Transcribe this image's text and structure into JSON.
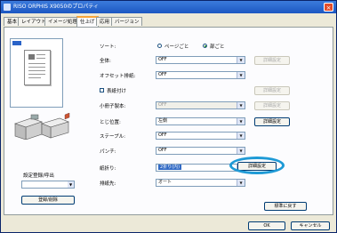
{
  "window": {
    "title": "RISO ORPHIS X9050のプロパティ"
  },
  "tabs": [
    {
      "label": "基本"
    },
    {
      "label": "レイアウト"
    },
    {
      "label": "イメージ処理"
    },
    {
      "label": "仕上げ"
    },
    {
      "label": "応用"
    },
    {
      "label": "バージョン"
    }
  ],
  "sort": {
    "label": "ソート:",
    "option1": "ページごと",
    "option2": "部ごと",
    "selected": "部ごと"
  },
  "rows": [
    {
      "label": "全体:",
      "value": "OFF",
      "button": "詳細設定",
      "button_enabled": false
    },
    {
      "label": "オフセット排紙:",
      "value": "OFF"
    },
    {
      "label": "表紙付け",
      "button": "詳細設定",
      "button_enabled": false
    },
    {
      "label": "小冊子製本:",
      "value": "OFF",
      "button": "詳細設定",
      "button_enabled": false
    },
    {
      "label": "とじ位置:",
      "value": "左側",
      "button": "詳細設定",
      "button_enabled": true
    },
    {
      "label": "ステープル:",
      "value": "OFF"
    },
    {
      "label": "パンチ:",
      "value": "OFF"
    },
    {
      "label": "紙折り:",
      "value": "2折り(内)",
      "button": "詳細設定",
      "button_enabled": true
    },
    {
      "label": "排紙先:",
      "value": "オート"
    }
  ],
  "left_panel": {
    "preset_label": "設定登録/呼出",
    "register_button": "登録/削除"
  },
  "footer": {
    "restore_defaults": "標準に戻す",
    "ok": "OK",
    "cancel": "キャンセル"
  },
  "colors": {
    "title_bar": "#1c57c2",
    "highlight_ring": "#1e9ad6",
    "selection": "#316ac5"
  }
}
